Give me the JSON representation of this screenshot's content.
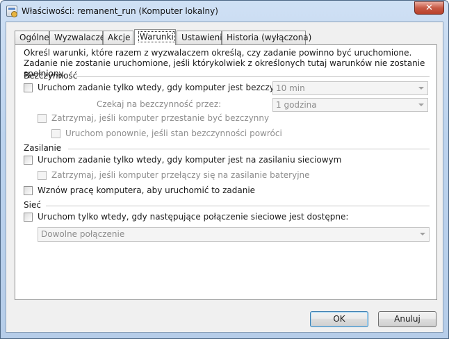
{
  "window": {
    "title": "Właściwości: remanent_run (Komputer lokalny)",
    "close_label": "✕"
  },
  "tabs": [
    {
      "label": "Ogólne",
      "active": false
    },
    {
      "label": "Wyzwalacze",
      "active": false
    },
    {
      "label": "Akcje",
      "active": false
    },
    {
      "label": "Warunki",
      "active": true
    },
    {
      "label": "Ustawienia",
      "active": false
    },
    {
      "label": "Historia (wyłączona)",
      "active": false
    }
  ],
  "description": "Określ warunki, które razem z wyzwalaczem określą, czy zadanie powinno być uruchomione. Zadanie nie zostanie uruchomione, jeśli którykolwiek z określonych tutaj warunków nie zostanie spełniony.",
  "idle": {
    "group_label": "Bezczynność",
    "start_if_idle": {
      "label": "Uruchom zadanie tylko wtedy, gdy komputer jest bezczynny",
      "checked": false,
      "value": "10 min"
    },
    "wait_for_idle": {
      "label": "Czekaj na bezczynność przez:",
      "value": "1 godzina"
    },
    "stop_if_not_idle": {
      "label": "Zatrzymaj, jeśli komputer przestanie być bezczynny",
      "checked": false
    },
    "restart_if_idle": {
      "label": "Uruchom ponownie, jeśli stan bezczynności powróci",
      "checked": false
    }
  },
  "power": {
    "group_label": "Zasilanie",
    "ac_only": {
      "label": "Uruchom zadanie tylko wtedy, gdy komputer jest na zasilaniu sieciowym",
      "checked": false
    },
    "stop_on_battery": {
      "label": "Zatrzymaj, jeśli komputer przełączy się na zasilanie bateryjne",
      "checked": false
    },
    "wake_to_run": {
      "label": "Wznów pracę komputera, aby uruchomić to zadanie",
      "checked": false
    }
  },
  "network": {
    "group_label": "Sieć",
    "only_if_network": {
      "label": "Uruchom tylko wtedy, gdy następujące połączenie sieciowe jest dostępne:",
      "checked": false
    },
    "connection": {
      "value": "Dowolne połączenie"
    }
  },
  "buttons": {
    "ok": "OK",
    "cancel": "Anuluj"
  }
}
